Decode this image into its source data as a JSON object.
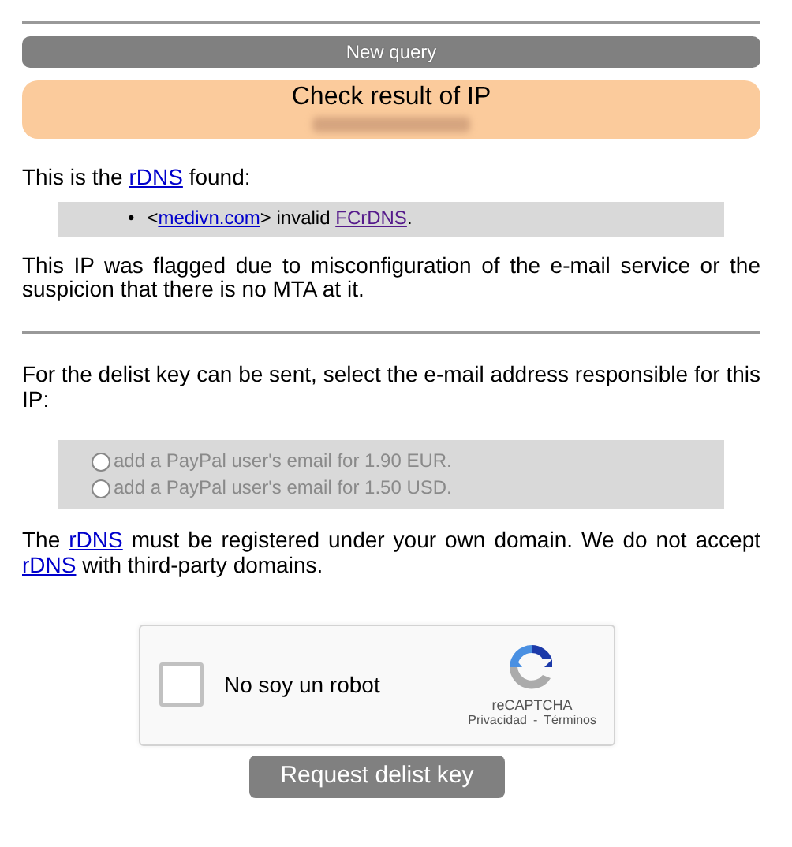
{
  "new_query_button": "New query",
  "result": {
    "title": "Check result of IP",
    "ip_redacted": true
  },
  "rdns_intro": [
    {
      "text": "This is the "
    },
    {
      "text": "rDNS",
      "link": true,
      "visited": false
    },
    {
      "text": " found:"
    }
  ],
  "rdns_list": [
    {
      "marker": "•",
      "parts": [
        {
          "text": "<"
        },
        {
          "text": "medivn.com",
          "link": true,
          "visited": false
        },
        {
          "text": "> invalid "
        },
        {
          "text": "FCrDNS",
          "link": true,
          "visited": true
        },
        {
          "text": "."
        }
      ]
    }
  ],
  "flag_note": [
    {
      "text": "This IP was flagged due to misconfiguration of the e-mail service or the suspicion that there is no MTA at it."
    }
  ],
  "select_prompt": [
    {
      "text": "For the delist key can be sent, select the e-mail address responsible for this IP:"
    }
  ],
  "email_options": [
    {
      "label": "add a PayPal user's email for 1.90 EUR.",
      "checked": false,
      "disabled": true
    },
    {
      "label": "add a PayPal user's email for 1.50 USD.",
      "checked": false,
      "disabled": true
    }
  ],
  "rdns_note": [
    {
      "text": "The "
    },
    {
      "text": "rDNS",
      "link": true,
      "visited": false
    },
    {
      "text": " must be registered under your own domain. We do not accept "
    },
    {
      "text": "rDNS",
      "link": true,
      "visited": false
    },
    {
      "text": " with third-party domains."
    }
  ],
  "captcha": {
    "label": "No soy un robot",
    "checked": false,
    "brand": "reCAPTCHA",
    "privacy": "Privacidad",
    "separator": "-",
    "terms": "Términos"
  },
  "submit_button": "Request delist key"
}
